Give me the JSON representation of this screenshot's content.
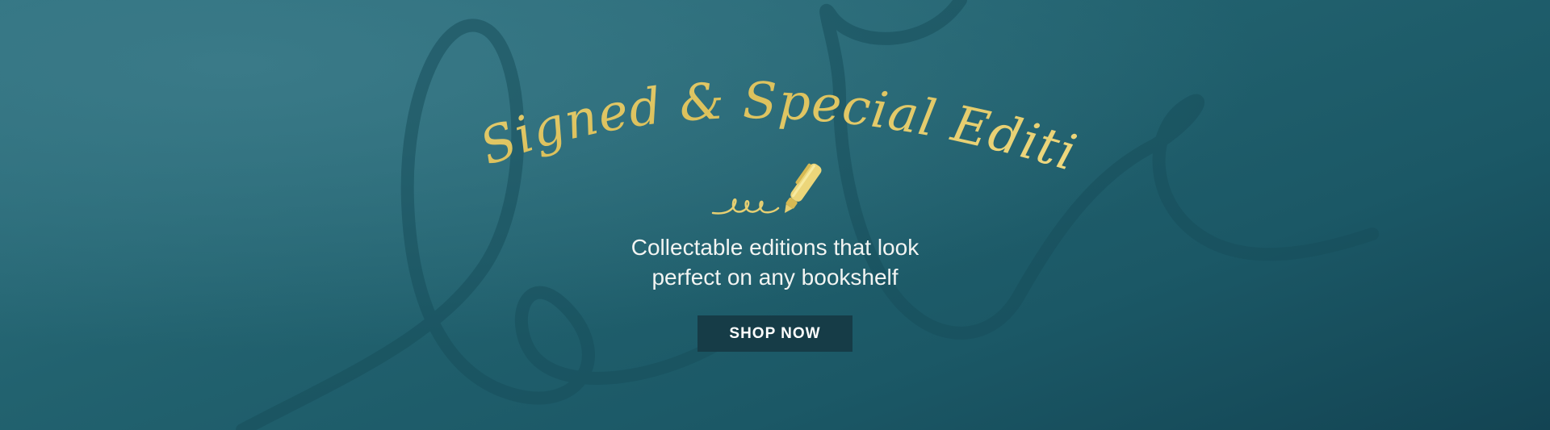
{
  "banner": {
    "headline": "Signed & Special Editions",
    "tagline_line1": "Collectable editions that look",
    "tagline_line2": "perfect on any bookshelf",
    "cta_label": "SHOP NOW"
  },
  "icons": {
    "pen": "fountain-pen-signature-icon",
    "background": "signature-swirl"
  },
  "colors": {
    "background_light": "#3a7a88",
    "background_dark": "#134453",
    "gold": "#e6cf72",
    "button": "#163c47",
    "text": "#f2f4f2"
  }
}
